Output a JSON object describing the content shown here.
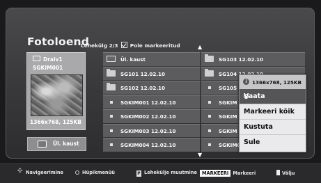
{
  "header": {
    "title": "Fotoloend",
    "page_info": "Lehekülg 2/3",
    "mark_status": "Pole markeeritud"
  },
  "info_card": {
    "drive": "Draiv1",
    "filename": "SGKIM001",
    "resolution": "1366x768, 125KB"
  },
  "up_folder_button": "Ül. kaust",
  "grid": {
    "rows": [
      [
        "Ül. kaust",
        "SG103 12.02.10"
      ],
      [
        "SG101 12.02.10",
        "SG104 12.02.10"
      ],
      [
        "SG102 12.02.10",
        "SG105"
      ],
      [
        "SGKIM001 12.02.10",
        "SGKIM"
      ],
      [
        "SGKIM002 12.02.10",
        "SGKIM"
      ],
      [
        "SGKIM003 12.02.10",
        "SGKIM"
      ],
      [
        "SGKIM004 12.02.10",
        "SGKIM005 12.02.10"
      ]
    ]
  },
  "popup": {
    "header": "1366x768, 125KB",
    "items": [
      "Vaata",
      "Markeeri kõik",
      "Kustuta",
      "Sule"
    ]
  },
  "bottom_bar": {
    "navigate": "Navigeerimine",
    "popup_menu": "Hüpikmenüü",
    "page_change": "Lehekülje muutmine",
    "mark_key": "MARKEERI",
    "mark": "Markeeri",
    "exit": "Välju"
  }
}
